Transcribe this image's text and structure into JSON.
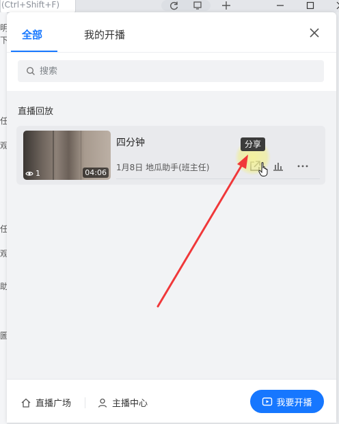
{
  "background": {
    "shortcut_hint": "(Ctrl+Shift+F)",
    "left_fragments": [
      "明",
      "下",
      "任)",
      "观",
      "任",
      "观",
      "助",
      "圖"
    ]
  },
  "panel": {
    "tabs": [
      {
        "label": "全部",
        "active": true
      },
      {
        "label": "我的开播",
        "active": false
      }
    ],
    "search": {
      "placeholder": "搜索",
      "value": ""
    },
    "section_title": "直播回放",
    "recording": {
      "title": "四分钟",
      "meta": "1月8日 地瓜助手(班主任)",
      "views": "1",
      "duration": "04:06",
      "tooltip": "分享"
    },
    "footer": {
      "plaza_label": "直播广场",
      "center_label": "主播中心",
      "go_live_label": "我要开播"
    }
  },
  "colors": {
    "accent": "#1677ff",
    "annotation_arrow": "#f0383a"
  }
}
